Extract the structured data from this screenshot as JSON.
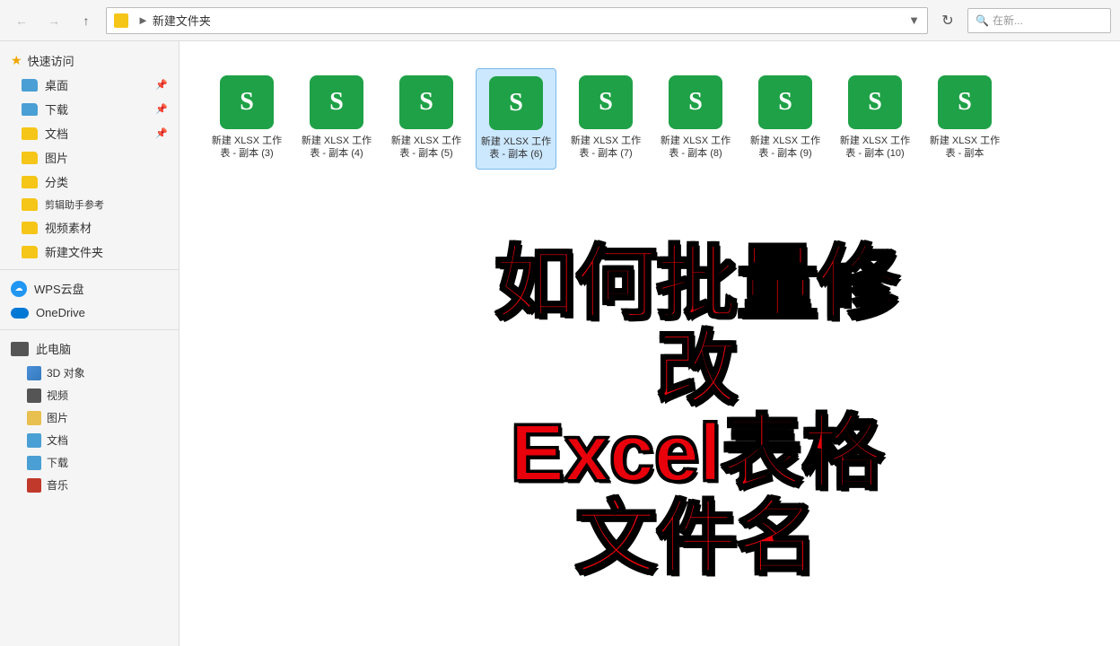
{
  "titlebar": {
    "address": "新建文件夹",
    "search_placeholder": "在新...",
    "back_label": "←",
    "forward_label": "→",
    "up_label": "↑"
  },
  "sidebar": {
    "quick_access_label": "快速访问",
    "items": [
      {
        "label": "桌面",
        "type": "folder"
      },
      {
        "label": "下载",
        "type": "folder"
      },
      {
        "label": "文档",
        "type": "folder"
      },
      {
        "label": "图片",
        "type": "folder"
      },
      {
        "label": "分类",
        "type": "folder"
      },
      {
        "label": "剪辑助手参考",
        "type": "folder"
      },
      {
        "label": "视频素材",
        "type": "folder"
      },
      {
        "label": "新建文件夹",
        "type": "folder"
      }
    ],
    "wps_label": "WPS云盘",
    "onedrive_label": "OneDrive",
    "computer_label": "此电脑",
    "sub_items": [
      {
        "label": "3D 对象",
        "type": "cube"
      },
      {
        "label": "视频",
        "type": "video-icon"
      },
      {
        "label": "图片",
        "type": "img-icon"
      },
      {
        "label": "文档",
        "type": "doc-icon"
      },
      {
        "label": "下载",
        "type": "dl-icon"
      },
      {
        "label": "音乐",
        "type": "music-icon"
      }
    ]
  },
  "files": [
    {
      "name": "新建 XLSX 工作表 - 副本 (3)",
      "selected": false
    },
    {
      "name": "新建 XLSX 工作表 - 副本 (4)",
      "selected": false
    },
    {
      "name": "新建 XLSX 工作表 - 副本 (5)",
      "selected": false
    },
    {
      "name": "新建 XLSX 工作表 - 副本 (6)",
      "selected": true
    },
    {
      "name": "新建 XLSX 工作表 - 副本 (7)",
      "selected": false
    },
    {
      "name": "新建 XLSX 工作表 - 副本 (8)",
      "selected": false
    },
    {
      "name": "新建 XLSX 工作表 - 副本 (9)",
      "selected": false
    },
    {
      "name": "新建 XLSX 工作表 - 副本 (10)",
      "selected": false
    },
    {
      "name": "新建 XLSX 工作表 - 副本",
      "selected": false
    }
  ],
  "overlay": {
    "line1": "如何批量修改",
    "line2": "Excel表格文件名"
  }
}
